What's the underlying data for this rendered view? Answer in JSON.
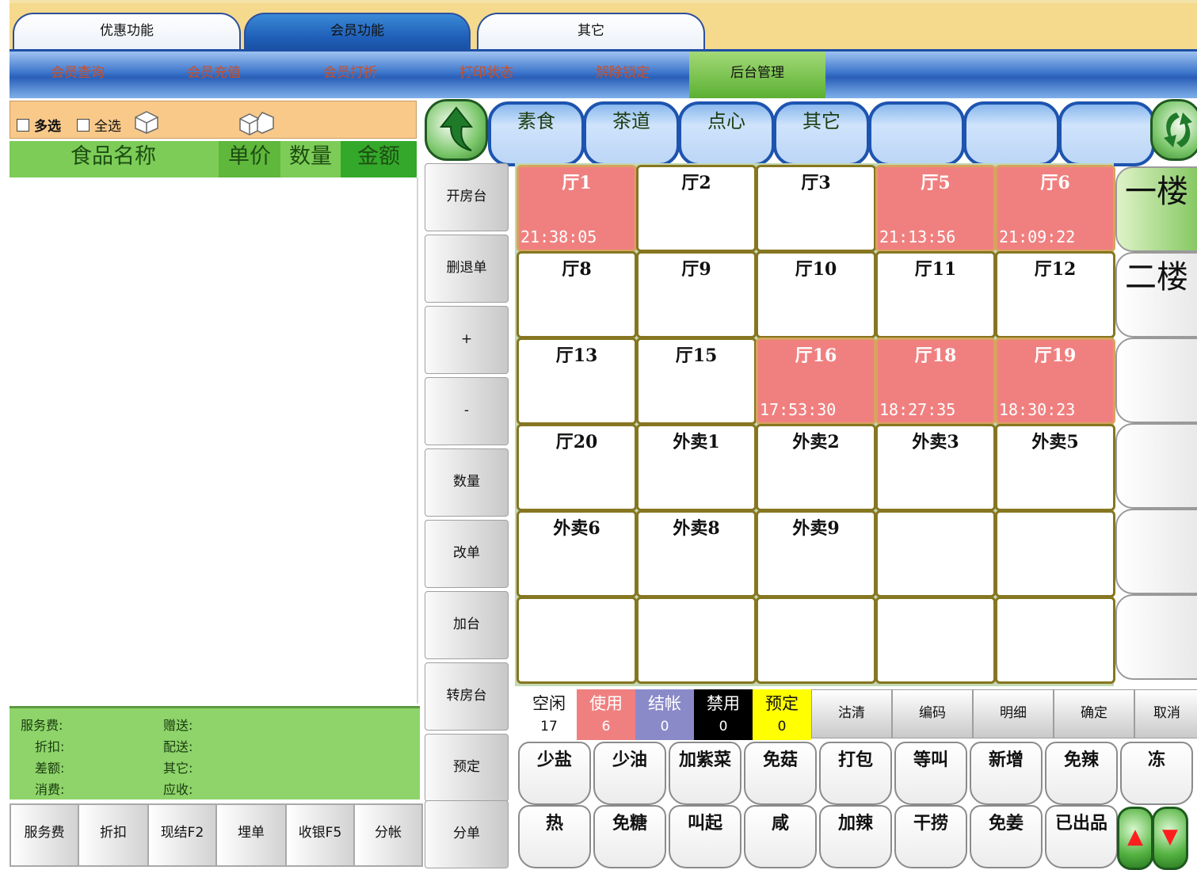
{
  "top_tabs": [
    {
      "label": "优惠功能"
    },
    {
      "label": "会员功能",
      "active": true
    },
    {
      "label": "其它"
    }
  ],
  "sub_nav": [
    {
      "label": "会员查询"
    },
    {
      "label": "会员充值"
    },
    {
      "label": "会员打折"
    },
    {
      "label": "打印状态"
    },
    {
      "label": "解除锁定"
    },
    {
      "label": "后台管理",
      "active": true
    }
  ],
  "left_panel": {
    "multi_select": "多选",
    "select_all": "全选",
    "columns": [
      "食品名称",
      "单价",
      "数量",
      "金额"
    ],
    "summary": {
      "col1": [
        "服务费:",
        "折扣:",
        "差额:",
        "消费:"
      ],
      "col2": [
        "赠送:",
        "配送:",
        "其它:",
        "应收:"
      ]
    },
    "bottom_buttons": [
      "服务费",
      "折扣",
      "现结F2",
      "埋单",
      "收银F5",
      "分帐"
    ]
  },
  "categories": [
    "素食",
    "茶道",
    "点心",
    "其它",
    "",
    "",
    ""
  ],
  "side_buttons": [
    "开房台",
    "删退单",
    "+",
    "-",
    "数量",
    "改单",
    "加台",
    "转房台",
    "预定",
    "分单"
  ],
  "tables": [
    {
      "name": "厅1",
      "time": "21:38:05",
      "status": "used"
    },
    {
      "name": "厅2",
      "time": "",
      "status": "free"
    },
    {
      "name": "厅3",
      "time": "",
      "status": "free"
    },
    {
      "name": "厅5",
      "time": "21:13:56",
      "status": "used"
    },
    {
      "name": "厅6",
      "time": "21:09:22",
      "status": "used"
    },
    {
      "name": "厅8",
      "time": "",
      "status": "free"
    },
    {
      "name": "厅9",
      "time": "",
      "status": "free"
    },
    {
      "name": "厅10",
      "time": "",
      "status": "free"
    },
    {
      "name": "厅11",
      "time": "",
      "status": "free"
    },
    {
      "name": "厅12",
      "time": "",
      "status": "free"
    },
    {
      "name": "厅13",
      "time": "",
      "status": "free"
    },
    {
      "name": "厅15",
      "time": "",
      "status": "free"
    },
    {
      "name": "厅16",
      "time": "17:53:30",
      "status": "used"
    },
    {
      "name": "厅18",
      "time": "18:27:35",
      "status": "used"
    },
    {
      "name": "厅19",
      "time": "18:30:23",
      "status": "used"
    },
    {
      "name": "厅20",
      "time": "",
      "status": "free"
    },
    {
      "name": "外卖1",
      "time": "",
      "status": "free"
    },
    {
      "name": "外卖2",
      "time": "",
      "status": "free"
    },
    {
      "name": "外卖3",
      "time": "",
      "status": "free"
    },
    {
      "name": "外卖5",
      "time": "",
      "status": "free"
    },
    {
      "name": "外卖6",
      "time": "",
      "status": "free"
    },
    {
      "name": "外卖8",
      "time": "",
      "status": "free"
    },
    {
      "name": "外卖9",
      "time": "",
      "status": "free"
    },
    {
      "name": "",
      "time": "",
      "status": "free"
    },
    {
      "name": "",
      "time": "",
      "status": "free"
    },
    {
      "name": "",
      "time": "",
      "status": "free"
    },
    {
      "name": "",
      "time": "",
      "status": "free"
    },
    {
      "name": "",
      "time": "",
      "status": "free"
    },
    {
      "name": "",
      "time": "",
      "status": "free"
    },
    {
      "name": "",
      "time": "",
      "status": "free"
    }
  ],
  "floors": [
    "一楼",
    "二楼",
    "",
    "",
    "",
    ""
  ],
  "status_legend": [
    {
      "label": "空闲",
      "count": "17",
      "bg": "#ffffff",
      "color": "#111111"
    },
    {
      "label": "使用",
      "count": "6",
      "bg": "#f08080",
      "color": "#ffffff"
    },
    {
      "label": "结帐",
      "count": "0",
      "bg": "#8a8ac9",
      "color": "#ffffff"
    },
    {
      "label": "禁用",
      "count": "0",
      "bg": "#000000",
      "color": "#ffffff"
    },
    {
      "label": "预定",
      "count": "0",
      "bg": "#ffff00",
      "color": "#111111"
    }
  ],
  "action_buttons": [
    "沽清",
    "编码",
    "明细",
    "确定",
    "取消"
  ],
  "remarks_row1": [
    "少盐",
    "少油",
    "加紫菜",
    "免菇",
    "打包",
    "等叫",
    "新增",
    "免辣",
    "冻"
  ],
  "remarks_row2": [
    "热",
    "免糖",
    "叫起",
    "咸",
    "加辣",
    "干捞",
    "免姜",
    "已出品"
  ],
  "colors": {
    "used": "#f08080",
    "accent_blue": "#1e54b0",
    "green": "#7ccc57"
  }
}
